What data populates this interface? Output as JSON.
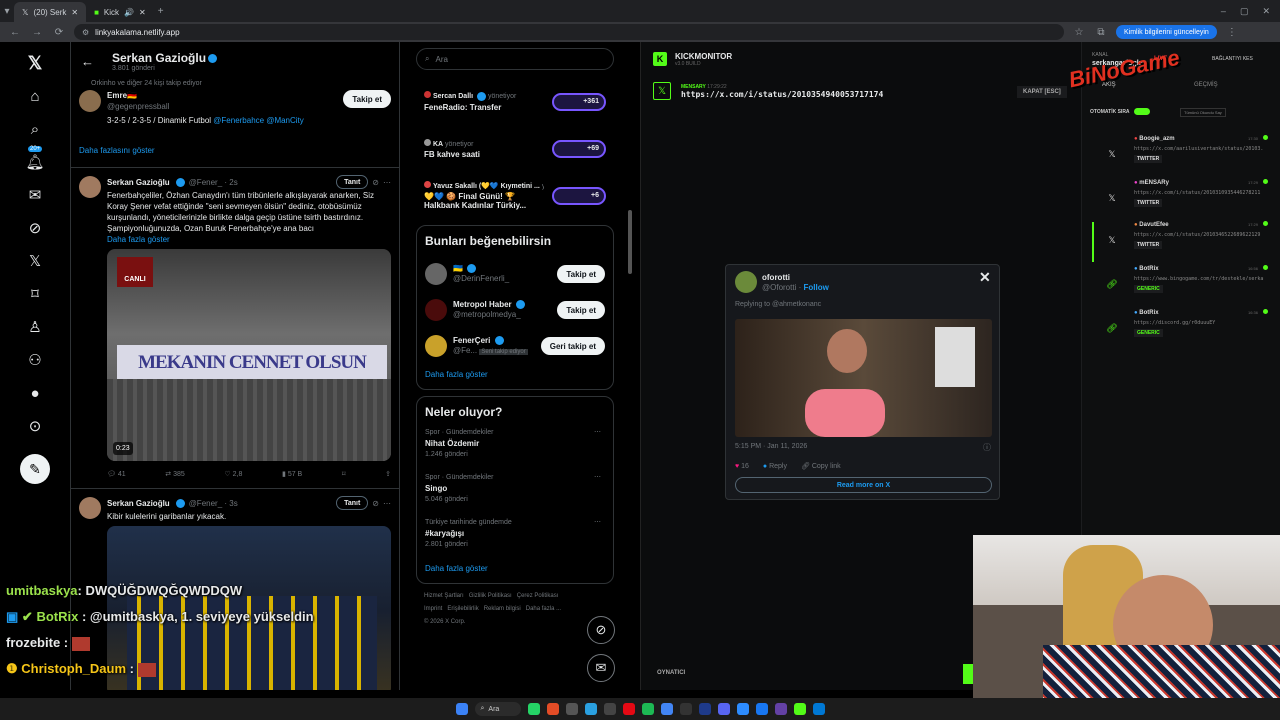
{
  "browser": {
    "tabs": [
      {
        "label": "(20) Serk"
      },
      {
        "label": "Kick"
      }
    ],
    "url": "linkyakalama.netlify.app",
    "profile_label": "Kimlik bilgilerini güncelleyin"
  },
  "x_nav": {
    "badge_count": "20+"
  },
  "timeline": {
    "header": {
      "name": "Serkan Gazioğlu",
      "posts": "3.801 gönderi"
    },
    "follow_note": "Orkinho ve diğer 24 kişi takip ediyor",
    "follow_card": {
      "name": "Emre🇩🇪",
      "handle": "@gegenpressball",
      "bio_text": "3-2-5 / 2-3-5 / Dinamik Futbol",
      "bio_links": "@Fenerbahce @ManCity",
      "follow_label": "Takip et"
    },
    "show_more": "Daha fazlasını göster",
    "tweets": [
      {
        "name": "Serkan Gazioğlu",
        "handle_time": "@Fener_ · 2s",
        "tanit": "Tanıt",
        "text": "Fenerbahçeliler, Özhan Canaydın'ı tüm tribünlerle alkışlayarak anarken, Siz Koray Şener vefat ettiğinde \"seni sevmeyen ölsün\" dediniz, otobüsümüz kurşunlandı, yöneticilerinizle birlikte dalga geçip üstüne tsirth bastırdınız. Şampiyonluğunuzda, Ozan Buruk Fenerbahçe'ye ana bacı",
        "more": "Daha fazla göster",
        "banner_text": "MEKANIN CENNET OLSUN",
        "channel": "CANLI",
        "duration": "0:23",
        "stats": {
          "replies": "41",
          "reposts": "385",
          "likes": "2,8",
          "views": "57 B"
        }
      },
      {
        "name": "Serkan Gazioğlu",
        "handle_time": "@Fener_ · 3s",
        "tanit": "Tanıt",
        "text": "Kibir kulelerini garibanlar yıkacak."
      }
    ]
  },
  "sidebar": {
    "search_placeholder": "Ara",
    "spaces": [
      {
        "host": "Sercan Dallı",
        "role": "yönetiyor",
        "title": "FeneRadio: Transfer",
        "count": "+361"
      },
      {
        "host": "KA",
        "role": "yönetiyor",
        "title": "FB kahve saati",
        "count": "+69"
      },
      {
        "host": "Yavuz Sakallı (💛💙 Kıymetini ...",
        "role": "yönetiyor",
        "title": "💛💙 🍪 Final Günü! 🏆 Halkbank Kadınlar Türkiy...",
        "count": "+6"
      }
    ],
    "who_to_follow": {
      "title": "Bunları beğenebilirsin",
      "items": [
        {
          "name": "🇺🇦",
          "handle": "@DerinFenerli_",
          "button": "Takip et",
          "follows_you": ""
        },
        {
          "name": "Metropol Haber",
          "handle": "@metropolmedya_",
          "button": "Takip et",
          "follows_you": ""
        },
        {
          "name": "FenerÇeri",
          "handle": "@Fe...",
          "button": "Geri takip et",
          "follows_you": "Seni takip ediyor"
        }
      ],
      "more": "Daha fazla göster"
    },
    "trends": {
      "title": "Neler oluyor?",
      "items": [
        {
          "context": "Spor · Gündemdekiler",
          "name": "Nihat Özdemir",
          "posts": "1.246 gönderi"
        },
        {
          "context": "Spor · Gündemdekiler",
          "name": "Singo",
          "posts": "5.046 gönderi"
        },
        {
          "context": "Türkiye tarihinde gündemde",
          "name": "#karyağışı",
          "posts": "2.801 gönderi"
        }
      ],
      "more": "Daha fazla göster"
    },
    "footer": [
      "Hizmet Şartları",
      "Gizlilik Politikası",
      "Çerez Politikası",
      "Imprint",
      "Erişilebilirlik",
      "Reklam bilgisi",
      "Daha fazla ...",
      "© 2026 X Corp."
    ]
  },
  "kick": {
    "brand": "KICKMONITOR",
    "version": "v3.0 BUILD",
    "channel_label": "KANAL",
    "channel_name": "serkangazioglu",
    "live": "LIVE",
    "disconnect": "BAĞLANTIYI KES",
    "current_user": "MENSARY",
    "current_time": "17:29:22",
    "current_url": "https://x.com/i/status/2010354940053717174",
    "close_label": "KAPAT [ESC]",
    "tabs": [
      "AKIŞ",
      "GEÇMİŞ"
    ],
    "auto_label": "OTOMATİK SIRA",
    "clear_label": "Tümünü Okundu Say",
    "player_label": "OYNATICI",
    "feed": [
      {
        "user": "Boogie_azm",
        "link": "https://x.com/aarilusivertank/status/20103...",
        "tag": "TWITTER",
        "time": "17:30"
      },
      {
        "user": "mENSARy",
        "link": "https://x.com/i/status/2010310935446278211",
        "tag": "TWITTER",
        "time": "17:29"
      },
      {
        "user": "DavutEfee",
        "link": "https://x.com/i/status/2010346522689622129",
        "tag": "TWITTER",
        "time": "17:29"
      },
      {
        "user": "BotRix",
        "link": "https://www.bingogame.com/tr/destekle/serkan...",
        "tag": "GENERIC",
        "time": "16:56"
      },
      {
        "user": "BotRix",
        "link": "https://discord.gg/r0duuuEY",
        "tag": "GENERIC",
        "time": "16:36"
      }
    ]
  },
  "embed": {
    "name": "oforotti",
    "handle": "@Oforotti",
    "follow": "Follow",
    "reply_to": "Replying to @ahmetkonanc",
    "timestamp": "5:15 PM · Jan 11, 2026",
    "likes": "16",
    "reply": "Reply",
    "copy": "Copy link",
    "read_more": "Read more on X"
  },
  "chat": [
    {
      "user": "umitbaskya",
      "message": ": DWQÜĞDWQĞQWDDQW",
      "color": "#9be24c"
    },
    {
      "user": "BotRix",
      "message": ": @umitbaskya, 1. seviyeye yükseldin",
      "color": "#9be24c"
    },
    {
      "user": "frozebite",
      "message": ":",
      "color": "#ffffff"
    },
    {
      "user": "Christoph_Daum",
      "message": ":",
      "color": "#f5c518"
    }
  ],
  "overlay_logo": "BiNoGame",
  "taskbar_search": "Ara",
  "colors": {
    "x_blue": "#1d9bf0",
    "kick_green": "#53fc18",
    "space_purple": "#7856ff"
  }
}
